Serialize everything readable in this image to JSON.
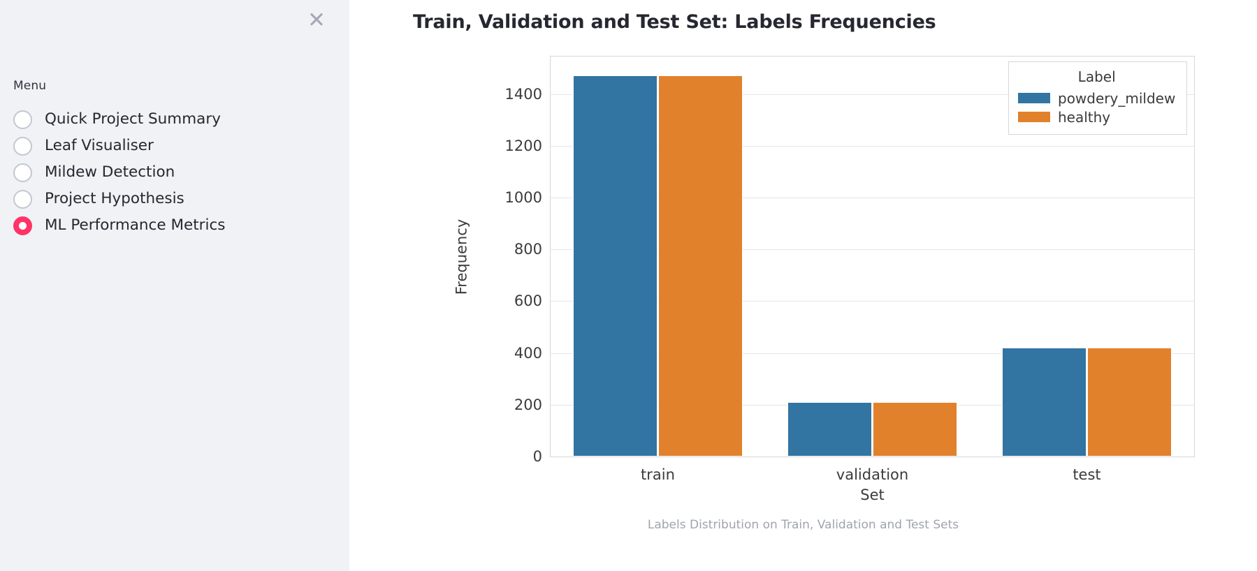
{
  "sidebar": {
    "close_icon": "close-icon",
    "menu_label": "Menu",
    "items": [
      {
        "label": "Quick Project Summary",
        "selected": false
      },
      {
        "label": "Leaf Visualiser",
        "selected": false
      },
      {
        "label": "Mildew Detection",
        "selected": false
      },
      {
        "label": "Project Hypothesis",
        "selected": false
      },
      {
        "label": "ML Performance Metrics",
        "selected": true
      }
    ],
    "background_color": "#f0f2f6",
    "accent_color": "#ff3366"
  },
  "main": {
    "page_title": "Train, Validation and Test Set: Labels Frequencies",
    "caption": "Labels Distribution on Train, Validation and Test Sets"
  },
  "chart_data": {
    "type": "bar",
    "title": "Train, Validation and Test Set: Labels Frequencies",
    "xlabel": "Set",
    "ylabel": "Frequency",
    "categories": [
      "train",
      "validation",
      "test"
    ],
    "series": [
      {
        "name": "powdery_mildew",
        "color": "#3274a2",
        "values": [
          1472,
          210,
          422
        ]
      },
      {
        "name": "healthy",
        "color": "#e1812c",
        "values": [
          1472,
          210,
          422
        ]
      }
    ],
    "legend_title": "Label",
    "legend_position": "upper right",
    "ylim": [
      0,
      1545
    ],
    "yticks": [
      0,
      200,
      400,
      600,
      800,
      1000,
      1200,
      1400
    ],
    "ytick_labels": [
      "0",
      "200",
      "400",
      "600",
      "800",
      "1000",
      "1200",
      "1400"
    ],
    "grid": "horizontal"
  }
}
